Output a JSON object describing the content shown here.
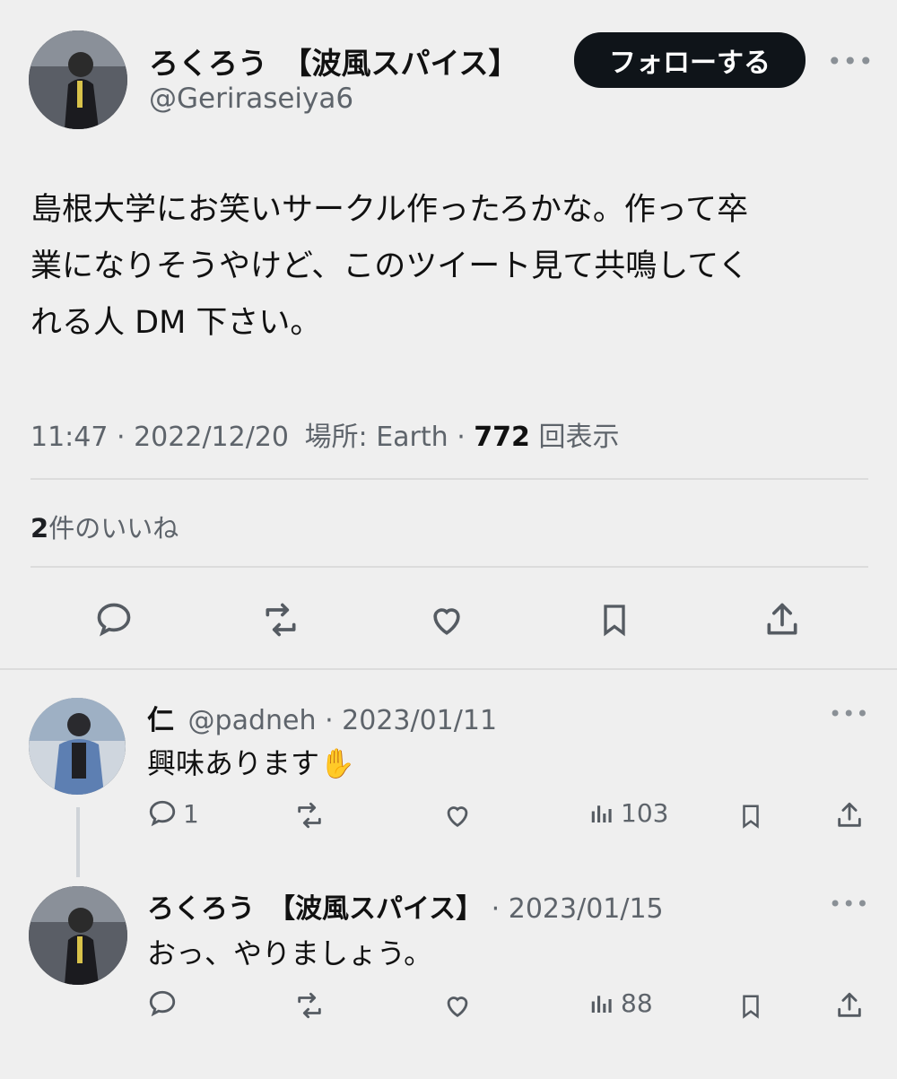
{
  "tweet": {
    "author_name": "ろくろう　【波風スパイス】",
    "author_handle": "@Geriraseiya6",
    "follow_label": "フォローする",
    "more_icon": "more-dots-icon",
    "text_lines": [
      "島根大学にお笑いサークル作ったろかな。作って卒",
      "業になりそうやけど、このツイート見て共鳴してく",
      "れる人 DM 下さい。"
    ],
    "time": "11:47",
    "date": "2022/12/20",
    "location_label": "場所: Earth",
    "views_count": "772",
    "views_label": "回表示",
    "likes_count": "2",
    "likes_label": "件のいいね",
    "actions": [
      "reply-icon",
      "retweet-icon",
      "like-icon",
      "bookmark-icon",
      "share-icon"
    ]
  },
  "replies": [
    {
      "name": "仁",
      "handle": "@padneh",
      "date": "2023/01/11",
      "text": "興味あります✋",
      "reply_count": "1",
      "views": "103"
    },
    {
      "name": "ろくろう　【波風スパイス】",
      "handle": "",
      "date": "2023/01/15",
      "text": "おっ、やりましょう。",
      "reply_count": "",
      "views": "88"
    }
  ]
}
